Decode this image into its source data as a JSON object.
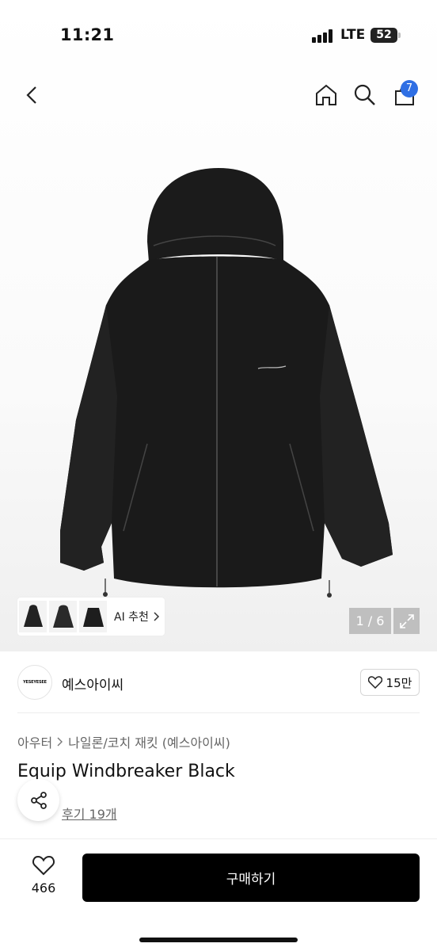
{
  "status_bar": {
    "time": "11:21",
    "network": "LTE",
    "battery": "52"
  },
  "header": {
    "cart_count": "7"
  },
  "gallery": {
    "ai_recommend_label": "AI 추천",
    "counter": "1 / 6"
  },
  "brand": {
    "name": "예스아이씨",
    "logo_text": "YESEYESEE",
    "likes": "15만"
  },
  "product": {
    "breadcrumb": [
      "아우터",
      "나일론/코치 재킷 (예스아이씨)"
    ],
    "title": "Equip Windbreaker Black",
    "reviews_label": "후기 19개"
  },
  "bottom": {
    "wish_count": "466",
    "buy_label": "구매하기"
  },
  "colors": {
    "accent": "#2f6fe4",
    "buy_button": "#000000"
  }
}
